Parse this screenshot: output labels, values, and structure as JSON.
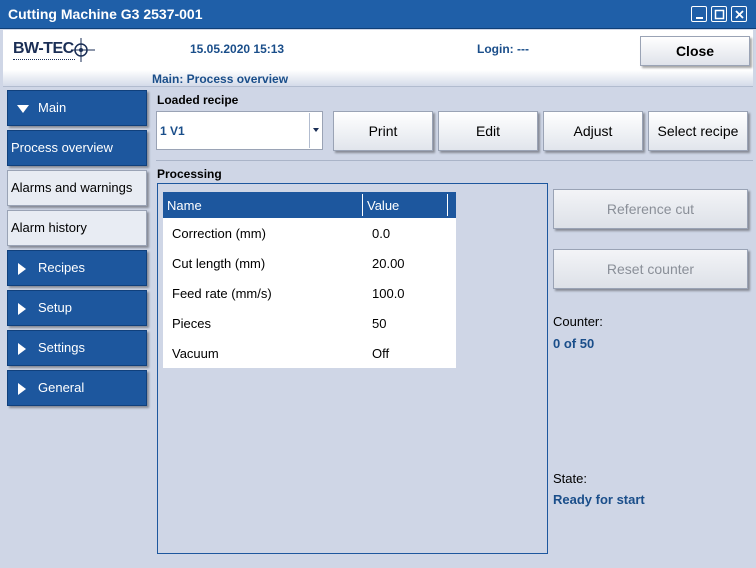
{
  "window": {
    "title": "Cutting Machine G3 2537-001"
  },
  "header": {
    "logo_text": "BW-TEC",
    "datetime": "15.05.2020 15:13",
    "login": "Login: ---",
    "close_label": "Close"
  },
  "breadcrumb": "Main: Process overview",
  "sidebar": {
    "items": [
      {
        "label": "Main"
      },
      {
        "label": "Process overview"
      },
      {
        "label": "Alarms and warnings"
      },
      {
        "label": "Alarm history"
      },
      {
        "label": "Recipes"
      },
      {
        "label": "Setup"
      },
      {
        "label": "Settings"
      },
      {
        "label": "General"
      }
    ]
  },
  "recipe": {
    "section_label": "Loaded recipe",
    "selected": "1 V1",
    "buttons": {
      "print": "Print",
      "edit": "Edit",
      "adjust": "Adjust",
      "select": "Select recipe"
    }
  },
  "processing": {
    "section_label": "Processing",
    "columns": {
      "name": "Name",
      "value": "Value"
    },
    "rows": [
      {
        "name": "Correction (mm)",
        "value": "0.0"
      },
      {
        "name": "Cut length (mm)",
        "value": "20.00"
      },
      {
        "name": "Feed rate (mm/s)",
        "value": "100.0"
      },
      {
        "name": "Pieces",
        "value": "50"
      },
      {
        "name": "Vacuum",
        "value": "Off"
      }
    ]
  },
  "actions": {
    "reference_cut": "Reference cut",
    "reset_counter": "Reset counter"
  },
  "counter": {
    "label": "Counter:",
    "value": "0 of 50"
  },
  "state": {
    "label": "State:",
    "value": "Ready for start"
  },
  "colors": {
    "title_bar": "#1f5fa8",
    "nav_blue": "#1d579e",
    "accent_text": "#1a4e8a",
    "background": "#cfd6e6"
  }
}
